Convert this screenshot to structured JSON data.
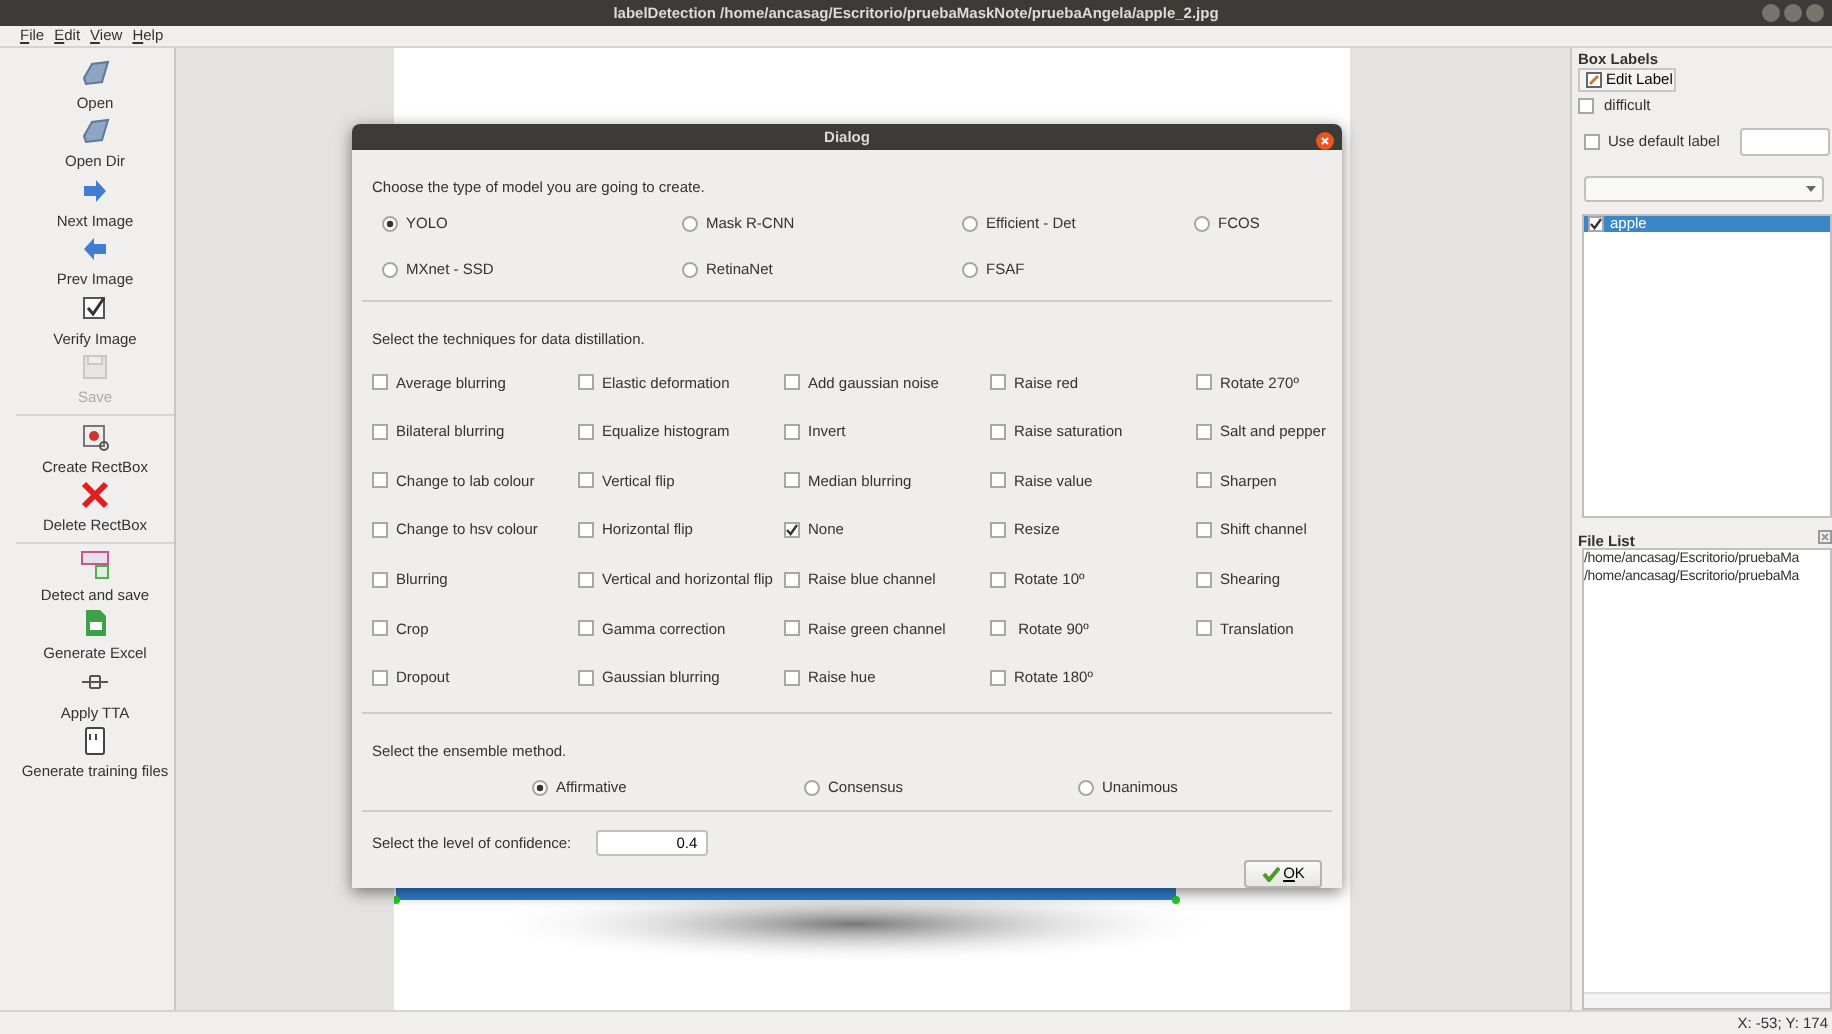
{
  "window": {
    "title": "labelDetection /home/ancasag/Escritorio/pruebaMaskNote/pruebaAngela/apple_2.jpg"
  },
  "menu": [
    "File",
    "Edit",
    "View",
    "Help"
  ],
  "toolbar": [
    {
      "items": [
        {
          "label": "Open",
          "kind": "folder",
          "disabled": false
        },
        {
          "label": "Open Dir",
          "kind": "folder",
          "disabled": false
        },
        {
          "label": "Next Image",
          "kind": "next",
          "disabled": false
        },
        {
          "label": "Prev Image",
          "kind": "prev",
          "disabled": false
        },
        {
          "label": "Verify Image",
          "kind": "check",
          "disabled": false
        },
        {
          "label": "Save",
          "kind": "save",
          "disabled": true
        }
      ]
    },
    {
      "items": [
        {
          "label": "Create RectBox",
          "kind": "rect",
          "disabled": false
        },
        {
          "label": "Delete RectBox",
          "kind": "delete",
          "disabled": false
        }
      ]
    },
    {
      "items": [
        {
          "label": "Detect and save",
          "kind": "detect",
          "disabled": false
        },
        {
          "label": "Generate Excel",
          "kind": "sheet",
          "disabled": false
        },
        {
          "label": "Apply TTA",
          "kind": "tta",
          "disabled": false
        },
        {
          "label": "Generate training files",
          "kind": "doc",
          "disabled": false
        }
      ]
    }
  ],
  "dialog": {
    "title": "Dialog",
    "model": {
      "prompt": "Choose the type of model you are going to create.",
      "options": [
        {
          "label": "YOLO",
          "selected": true
        },
        {
          "label": "Mask R-CNN",
          "selected": false
        },
        {
          "label": "Efficient - Det",
          "selected": false
        },
        {
          "label": "FCOS",
          "selected": false
        },
        {
          "label": "MXnet - SSD",
          "selected": false
        },
        {
          "label": "RetinaNet",
          "selected": false
        },
        {
          "label": "FSAF",
          "selected": false
        }
      ]
    },
    "techniques": {
      "prompt": "Select the techniques for data distillation.",
      "options": [
        {
          "label": "Average blurring",
          "checked": false
        },
        {
          "label": "Elastic deformation",
          "checked": false
        },
        {
          "label": "Add gaussian noise",
          "checked": false
        },
        {
          "label": "Raise red",
          "checked": false
        },
        {
          "label": "Rotate 270º",
          "checked": false
        },
        {
          "label": "Bilateral blurring",
          "checked": false
        },
        {
          "label": "Equalize histogram",
          "checked": false
        },
        {
          "label": "Invert",
          "checked": false
        },
        {
          "label": "Raise saturation",
          "checked": false
        },
        {
          "label": "Salt and pepper",
          "checked": false
        },
        {
          "label": "Change to lab colour",
          "checked": false
        },
        {
          "label": "Vertical flip",
          "checked": false
        },
        {
          "label": "Median blurring",
          "checked": false
        },
        {
          "label": "Raise value",
          "checked": false
        },
        {
          "label": "Sharpen",
          "checked": false
        },
        {
          "label": "Change to hsv colour",
          "checked": false
        },
        {
          "label": "Horizontal flip",
          "checked": false
        },
        {
          "label": "None",
          "checked": true
        },
        {
          "label": "Resize",
          "checked": false
        },
        {
          "label": "Shift channel",
          "checked": false
        },
        {
          "label": "Blurring",
          "checked": false
        },
        {
          "label": "Vertical and horizontal flip",
          "checked": false
        },
        {
          "label": "Raise blue channel",
          "checked": false
        },
        {
          "label": "Rotate 10º",
          "checked": false
        },
        {
          "label": "Shearing",
          "checked": false
        },
        {
          "label": "Crop",
          "checked": false
        },
        {
          "label": "Gamma correction",
          "checked": false
        },
        {
          "label": "Raise green channel",
          "checked": false
        },
        {
          "label": " Rotate 90º",
          "checked": false
        },
        {
          "label": "Translation",
          "checked": false
        },
        {
          "label": "Dropout",
          "checked": false
        },
        {
          "label": "Gaussian blurring",
          "checked": false
        },
        {
          "label": "Raise hue",
          "checked": false
        },
        {
          "label": "Rotate 180º",
          "checked": false
        }
      ]
    },
    "ensemble": {
      "prompt": "Select the ensemble method.",
      "options": [
        {
          "label": "Affirmative",
          "selected": true
        },
        {
          "label": "Consensus",
          "selected": false
        },
        {
          "label": "Unanimous",
          "selected": false
        }
      ]
    },
    "confidence": {
      "label": "Select the level of confidence:",
      "value": "0.4"
    },
    "ok": "OK"
  },
  "box_labels": {
    "title": "Box Labels",
    "edit_button": "Edit Label",
    "difficult": {
      "label": "difficult",
      "checked": false
    },
    "default_label": {
      "label": "Use default label",
      "checked": false
    },
    "labels": [
      {
        "label": "apple",
        "checked": true,
        "selected": true
      }
    ]
  },
  "file_list": {
    "title": "File List",
    "items": [
      "/home/ancasag/Escritorio/pruebaMa",
      "/home/ancasag/Escritorio/pruebaMa"
    ]
  },
  "status_bar": "X: -53; Y: 174"
}
